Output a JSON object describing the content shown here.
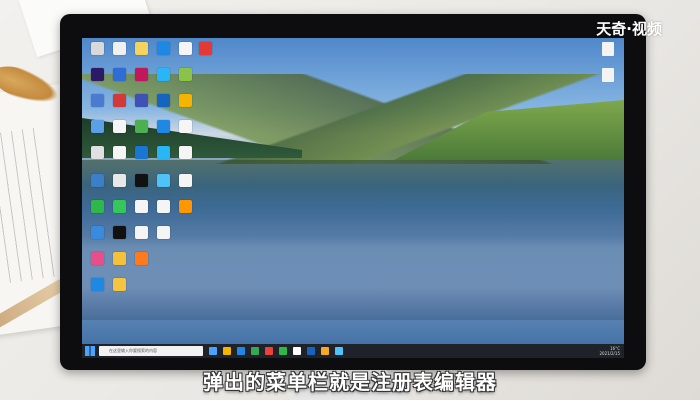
{
  "watermark": "天奇·视频",
  "caption": "弹出的菜单栏就是注册表编辑器",
  "taskbar": {
    "search_placeholder": "在这里输入你要搜索的内容",
    "weather": "16°C",
    "date": "2021/2/15"
  },
  "colors": {
    "monitor_frame": "#0d0d0f",
    "taskbar": "#1f2329",
    "caption_text": "#ffffff"
  }
}
